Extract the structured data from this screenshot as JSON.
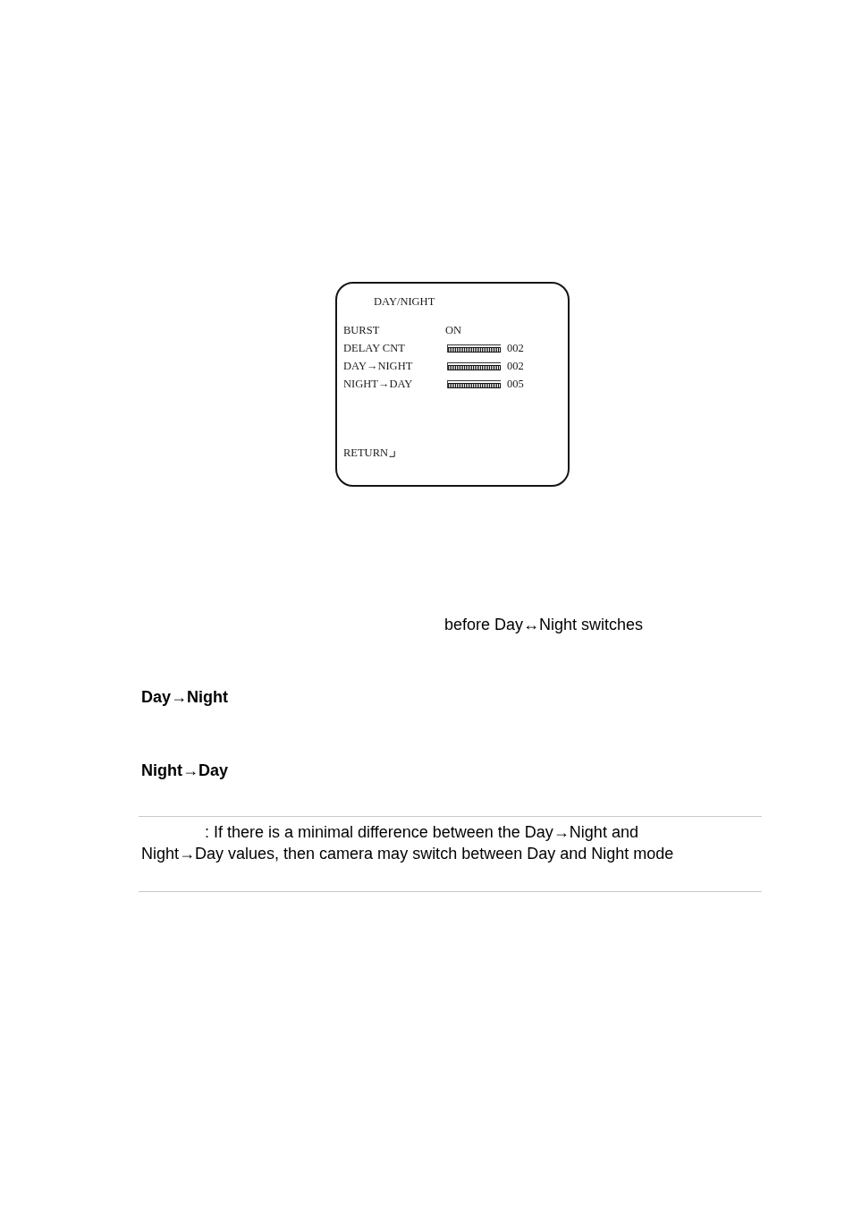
{
  "figure": {
    "title": "DAY/NIGHT",
    "rows": [
      {
        "kind": "value",
        "label": "BURST",
        "value": "ON"
      },
      {
        "kind": "slider",
        "label": "DELAY CNT",
        "level": 1,
        "value": "002"
      },
      {
        "kind": "slider",
        "label": "DAY→NIGHT",
        "level": 1,
        "value": "002"
      },
      {
        "kind": "slider",
        "label": "NIGHT→DAY",
        "level": 1,
        "value": "005"
      }
    ],
    "footer": "RETURN"
  },
  "caption": "before Day↔Night switches",
  "sections": [
    {
      "heading": "Day→Night"
    },
    {
      "heading": "Night→Day"
    }
  ],
  "note": {
    "text": ": If there is a minimal difference between the Day→Night and Night→Day values, then camera may switch between Day and Night mode"
  }
}
